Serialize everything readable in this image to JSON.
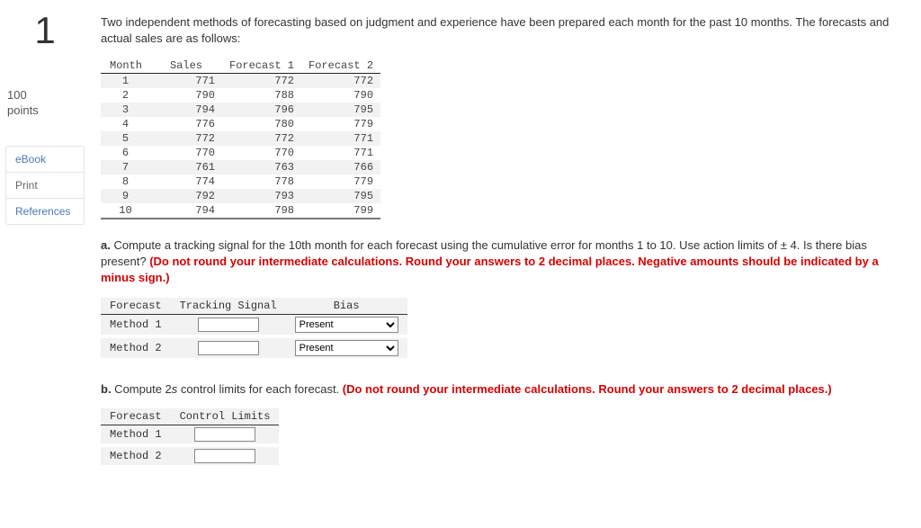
{
  "question_number": "1",
  "points_value": "100",
  "points_label": "points",
  "sidebar_links": [
    "eBook",
    "Print",
    "References"
  ],
  "intro": "Two independent methods of forecasting based on judgment and experience have been prepared each month for the past 10 months. The forecasts and actual sales are as follows:",
  "chart_data": {
    "type": "table",
    "headers": [
      "Month",
      "Sales",
      "Forecast 1",
      "Forecast 2"
    ],
    "rows": [
      [
        "1",
        "771",
        "772",
        "772"
      ],
      [
        "2",
        "790",
        "788",
        "790"
      ],
      [
        "3",
        "794",
        "796",
        "795"
      ],
      [
        "4",
        "776",
        "780",
        "779"
      ],
      [
        "5",
        "772",
        "772",
        "771"
      ],
      [
        "6",
        "770",
        "770",
        "771"
      ],
      [
        "7",
        "761",
        "763",
        "766"
      ],
      [
        "8",
        "774",
        "778",
        "779"
      ],
      [
        "9",
        "792",
        "793",
        "795"
      ],
      [
        "10",
        "794",
        "798",
        "799"
      ]
    ]
  },
  "part_a": {
    "label": "a.",
    "text": " Compute a tracking signal for the 10th month for each forecast using the cumulative error for months 1 to 10. Use action limits of ± 4. Is there bias present? ",
    "warn": "(Do not round your intermediate calculations. Round your answers to 2 decimal places. Negative amounts should be indicated by a minus sign.)"
  },
  "answer_a": {
    "headers": [
      "Forecast",
      "Tracking Signal",
      "Bias"
    ],
    "rows": [
      "Method 1",
      "Method 2"
    ],
    "bias_value": "Present"
  },
  "part_b": {
    "label": "b.",
    "text_before": " Compute 2",
    "text_italic": "s",
    "text_after": " control limits for each forecast. ",
    "warn": "(Do not round your intermediate calculations. Round your answers to 2 decimal places.)"
  },
  "answer_b": {
    "headers": [
      "Forecast",
      "Control Limits"
    ],
    "rows": [
      "Method 1",
      "Method 2"
    ]
  }
}
